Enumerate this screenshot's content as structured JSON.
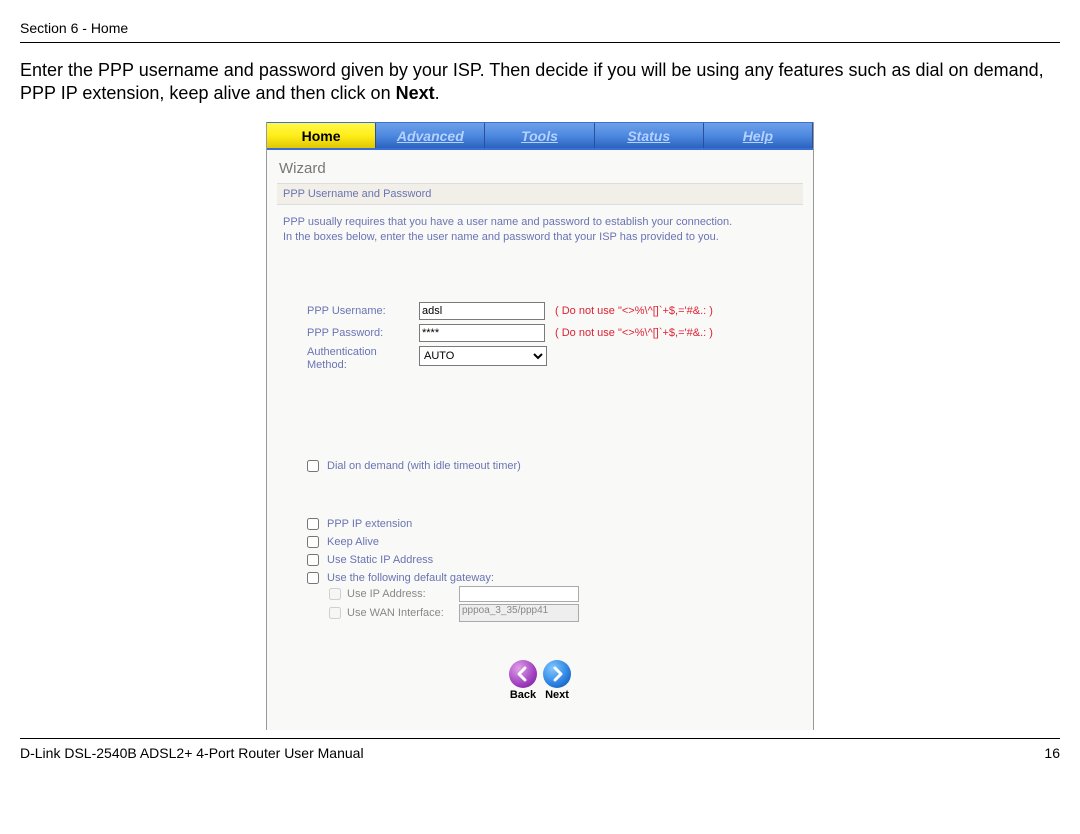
{
  "doc": {
    "section_header": "Section 6 - Home",
    "intro_text_pre": "Enter the PPP username and password given by your ISP. Then decide if you will be using any features such as dial on demand, PPP IP extension, keep alive and then click on ",
    "intro_bold": "Next",
    "intro_suffix": ".",
    "footer_left": "D-Link DSL-2540B ADSL2+ 4-Port Router User Manual",
    "footer_right": "16"
  },
  "tabs": {
    "home": "Home",
    "advanced": "Advanced",
    "tools": "Tools",
    "status": "Status",
    "help": "Help"
  },
  "panel": {
    "title": "Wizard",
    "subtitle": "PPP Username and Password",
    "desc_line1": "PPP usually requires that you have a user name and password to establish your connection.",
    "desc_line2": "In the boxes below, enter the user name and password that your ISP has provided to you."
  },
  "form": {
    "username_label": "PPP Username:",
    "username_value": "adsl",
    "username_hint": "( Do not use \"<>%\\^[]`+$,='#&.: )",
    "password_label": "PPP Password:",
    "password_value": "****",
    "password_hint": "( Do not use \"<>%\\^[]`+$,='#&.: )",
    "auth_label": "Authentication Method:",
    "auth_value": "AUTO"
  },
  "options": {
    "dial_on_demand": "Dial on demand (with idle timeout timer)",
    "ppp_ip_ext": "PPP IP extension",
    "keep_alive": "Keep Alive",
    "use_static_ip": "Use Static IP Address",
    "use_default_gw": "Use the following default gateway:",
    "use_ip_addr": "Use IP Address:",
    "use_wan_if": "Use WAN Interface:",
    "wan_if_value": "pppoa_3_35/ppp41"
  },
  "nav": {
    "back": "Back",
    "next": "Next"
  }
}
